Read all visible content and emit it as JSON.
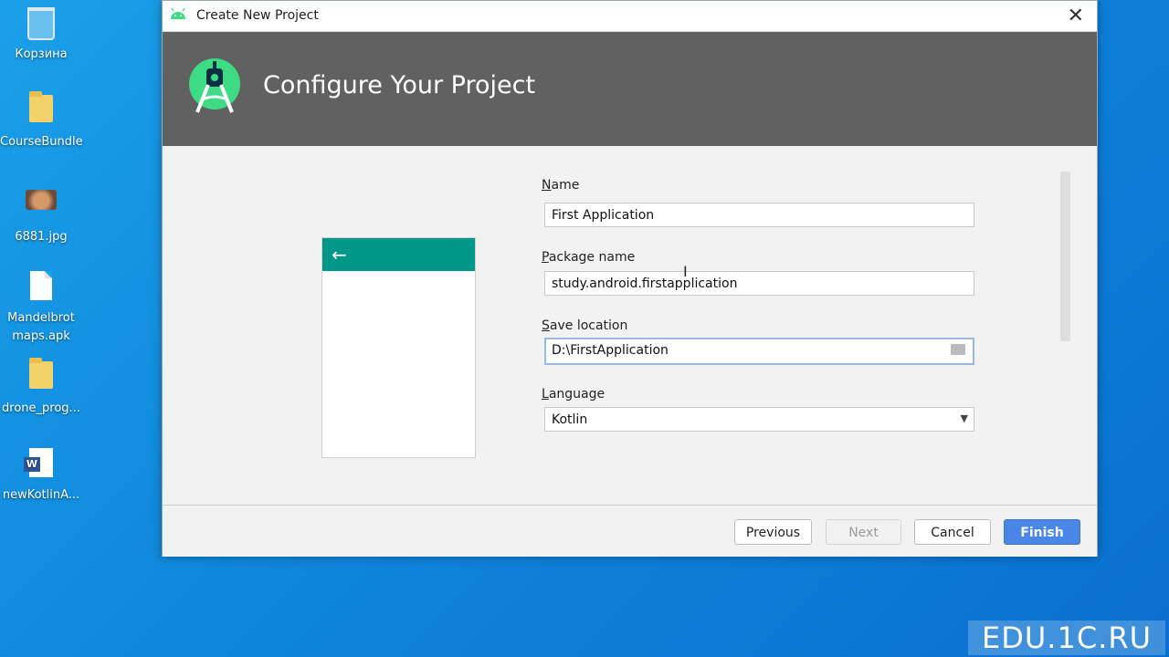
{
  "desktop": {
    "icons": [
      {
        "label": "Корзина"
      },
      {
        "label": "CourseBundle"
      },
      {
        "label": "6881.jpg"
      },
      {
        "label": "Mandelbrot maps.apk"
      },
      {
        "label": "drone_prog..."
      },
      {
        "label": "newKotlinA..."
      }
    ]
  },
  "dialog": {
    "title": "Create New Project",
    "heading": "Configure Your Project",
    "fields": {
      "name_label_mnemonic": "N",
      "name_label_rest": "ame",
      "name_value": "First Application",
      "package_label_mnemonic": "P",
      "package_label_rest": "ackage name",
      "package_value": "study.android.firstapplication",
      "save_label_mnemonic": "S",
      "save_label_rest": "ave location",
      "save_value": "D:\\FirstApplication",
      "language_label_mnemonic": "L",
      "language_label_rest": "anguage",
      "language_value": "Kotlin"
    },
    "buttons": {
      "previous": "Previous",
      "next": "Next",
      "cancel": "Cancel",
      "finish": "Finish"
    }
  },
  "watermark": "EDU.1C.RU",
  "colors": {
    "desktop": "#0f86dc",
    "banner": "#616161",
    "phone_bar": "#009688",
    "primary": "#4a86e8"
  }
}
